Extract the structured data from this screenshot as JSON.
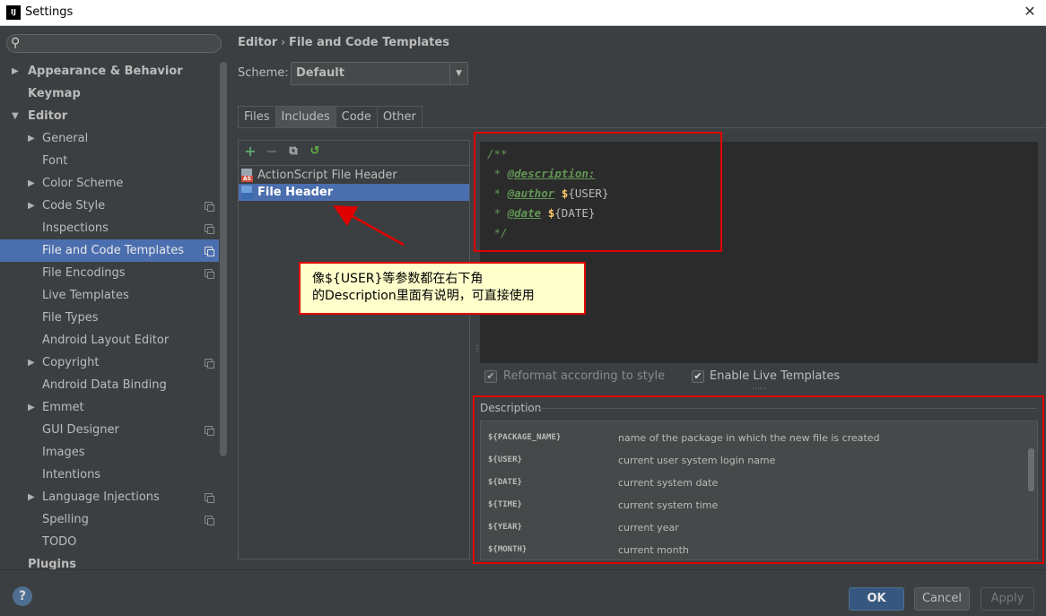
{
  "window": {
    "app_icon": "IJ",
    "title": "Settings",
    "close_symbol": "✕"
  },
  "sidebar": {
    "search_placeholder": "",
    "items": [
      {
        "label": "Appearance & Behavior",
        "level": 0,
        "arrow": "▶",
        "bold": true
      },
      {
        "label": "Keymap",
        "level": 0,
        "arrow": "",
        "bold": true
      },
      {
        "label": "Editor",
        "level": 0,
        "arrow": "▼",
        "bold": true
      },
      {
        "label": "General",
        "level": 1,
        "arrow": "▶"
      },
      {
        "label": "Font",
        "level": 1,
        "arrow": ""
      },
      {
        "label": "Color Scheme",
        "level": 1,
        "arrow": "▶"
      },
      {
        "label": "Code Style",
        "level": 1,
        "arrow": "▶",
        "project": true
      },
      {
        "label": "Inspections",
        "level": 1,
        "arrow": "",
        "project": true
      },
      {
        "label": "File and Code Templates",
        "level": 1,
        "arrow": "",
        "project": true,
        "selected": true
      },
      {
        "label": "File Encodings",
        "level": 1,
        "arrow": "",
        "project": true
      },
      {
        "label": "Live Templates",
        "level": 1,
        "arrow": ""
      },
      {
        "label": "File Types",
        "level": 1,
        "arrow": ""
      },
      {
        "label": "Android Layout Editor",
        "level": 1,
        "arrow": ""
      },
      {
        "label": "Copyright",
        "level": 1,
        "arrow": "▶",
        "project": true
      },
      {
        "label": "Android Data Binding",
        "level": 1,
        "arrow": ""
      },
      {
        "label": "Emmet",
        "level": 1,
        "arrow": "▶"
      },
      {
        "label": "GUI Designer",
        "level": 1,
        "arrow": "",
        "project": true
      },
      {
        "label": "Images",
        "level": 1,
        "arrow": ""
      },
      {
        "label": "Intentions",
        "level": 1,
        "arrow": ""
      },
      {
        "label": "Language Injections",
        "level": 1,
        "arrow": "▶",
        "project": true
      },
      {
        "label": "Spelling",
        "level": 1,
        "arrow": "",
        "project": true
      },
      {
        "label": "TODO",
        "level": 1,
        "arrow": ""
      },
      {
        "label": "Plugins",
        "level": 0,
        "arrow": "",
        "bold": true
      }
    ]
  },
  "breadcrumb": {
    "part1": "Editor",
    "separator": "›",
    "part2": "File and Code Templates"
  },
  "scheme": {
    "label": "Scheme:",
    "value": "Default",
    "dropdown_symbol": "▼"
  },
  "tabs": [
    {
      "label": "Files",
      "active": false
    },
    {
      "label": "Includes",
      "active": true
    },
    {
      "label": "Code",
      "active": false
    },
    {
      "label": "Other",
      "active": false
    }
  ],
  "toolbar": {
    "add": "+",
    "remove": "−",
    "copy": "⧉",
    "reset": "↺"
  },
  "templates": [
    {
      "label": "ActionScript File Header",
      "icon": "AS",
      "selected": false
    },
    {
      "label": "File Header",
      "icon": "",
      "selected": true
    }
  ],
  "editor": {
    "line1": "/**",
    "line2_prefix": " * ",
    "line2_tag": "@description:",
    "line3_prefix": " * ",
    "line3_tag": "@author",
    "line3_dollar": "$",
    "line3_var": "{USER}",
    "line4_prefix": " * ",
    "line4_tag": "@date",
    "line4_dollar": "$",
    "line4_var": "{DATE}",
    "line5": " */"
  },
  "options": {
    "reformat_label": "Reformat according to style",
    "reformat_checked": true,
    "live_templates_label": "Enable Live Templates",
    "live_templates_checked": true,
    "check_symbol": "✔"
  },
  "description": {
    "title": "Description",
    "rows": [
      {
        "var": "${PACKAGE_NAME}",
        "text": "name of the package in which the new file is created"
      },
      {
        "var": "${USER}",
        "text": "current user system login name"
      },
      {
        "var": "${DATE}",
        "text": "current system date"
      },
      {
        "var": "${TIME}",
        "text": "current system time"
      },
      {
        "var": "${YEAR}",
        "text": "current year"
      },
      {
        "var": "${MONTH}",
        "text": "current month"
      }
    ]
  },
  "annotation": {
    "line1": "像${USER}等参数都在右下角",
    "line2": "的Description里面有说明，可直接使用"
  },
  "footer": {
    "help": "?",
    "ok": "OK",
    "cancel": "Cancel",
    "apply": "Apply"
  },
  "colors": {
    "accent": "#4b6eaf",
    "annotation_red": "#e00000",
    "callout_bg": "#ffffcc"
  }
}
